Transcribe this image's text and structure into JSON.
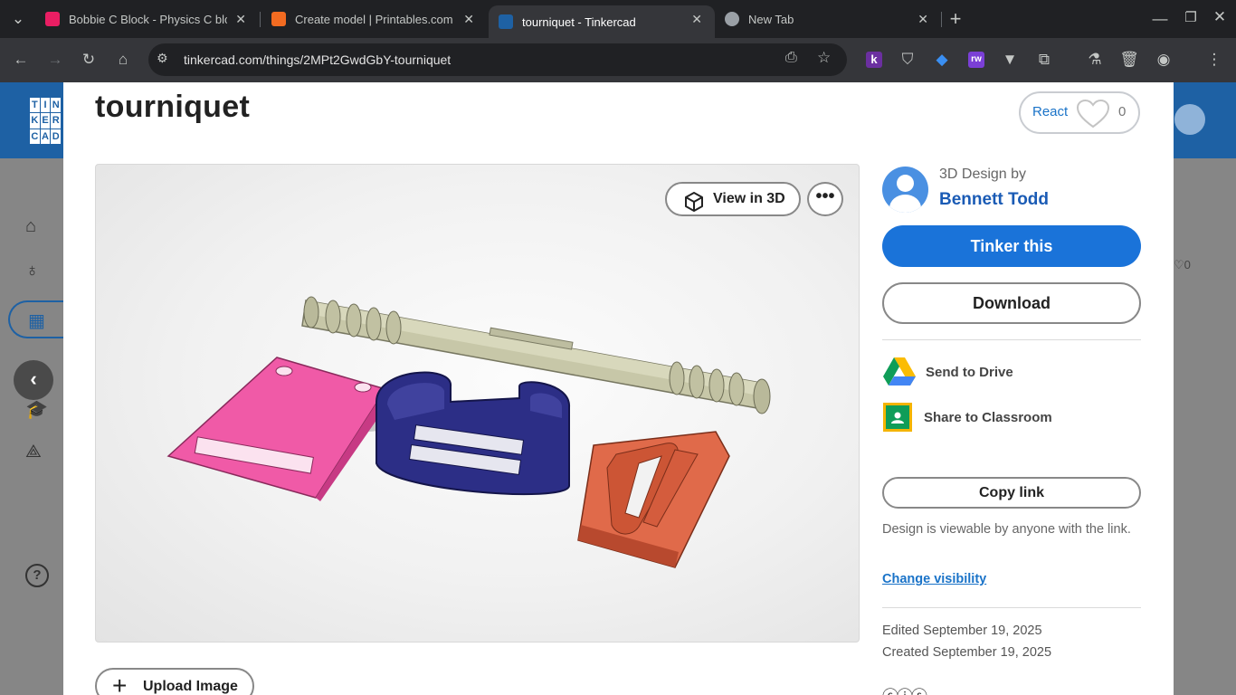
{
  "browser": {
    "tabs": [
      {
        "title": "Bobbie C Block - Physics C bloc",
        "active": false,
        "favicon_color": "#e91e63"
      },
      {
        "title": "Create model | Printables.com",
        "active": false,
        "favicon_color": "#f26b21"
      },
      {
        "title": "tourniquet - Tinkercad",
        "active": true,
        "favicon_color": "#1e61a4"
      },
      {
        "title": "New Tab",
        "active": false,
        "favicon_color": "#9aa0a6"
      }
    ],
    "url": "tinkercad.com/things/2MPt2GwdGbY-tourniquet"
  },
  "tinkercad": {
    "logo_letters": [
      "T",
      "I",
      "N",
      "K",
      "E",
      "R",
      "C",
      "A",
      "D"
    ],
    "brand_color": "#1e61a4"
  },
  "design": {
    "title": "tourniquet",
    "react_label": "React",
    "react_count": "0",
    "view_in_3d": "View in 3D",
    "more": "•••",
    "upload_image": "Upload Image"
  },
  "sidebar": {
    "byline": "3D Design by",
    "author": "Bennett Todd",
    "tinker_this": "Tinker this",
    "download": "Download",
    "send_to_drive": "Send to Drive",
    "share_to_classroom": "Share to Classroom",
    "copy_link": "Copy link",
    "viewable_text": "Design is viewable by anyone with the link.",
    "change_visibility": "Change visibility",
    "edited": "Edited September 19, 2025",
    "created": "Created September 19, 2025"
  }
}
